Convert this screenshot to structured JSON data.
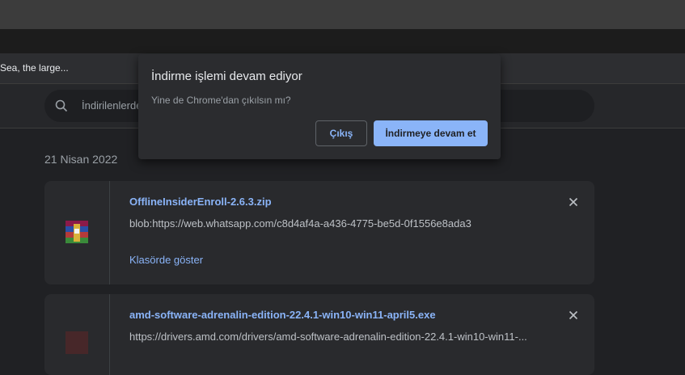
{
  "bookmarks": {
    "item1": "Sea, the large..."
  },
  "search": {
    "placeholder": "İndirilenlerde"
  },
  "downloads": {
    "date": "21 Nisan 2022",
    "items": [
      {
        "name": "OfflineInsiderEnroll-2.6.3.zip",
        "url": "blob:https://web.whatsapp.com/c8d4af4a-a436-4775-be5d-0f1556e8ada3",
        "action": "Klasörde göster",
        "icon": "winrar-archive-icon"
      },
      {
        "name": "amd-software-adrenalin-edition-22.4.1-win10-win11-april5.exe",
        "url": "https://drivers.amd.com/drivers/amd-software-adrenalin-edition-22.4.1-win10-win11-...",
        "icon": "amd-installer-icon"
      }
    ]
  },
  "dialog": {
    "title": "İndirme işlemi devam ediyor",
    "message": "Yine de Chrome'dan çıkılsın mı?",
    "exit_label": "Çıkış",
    "continue_label": "İndirmeye devam et"
  },
  "colors": {
    "accent": "#8ab4f8",
    "background": "#202124",
    "card": "#292a2d"
  }
}
